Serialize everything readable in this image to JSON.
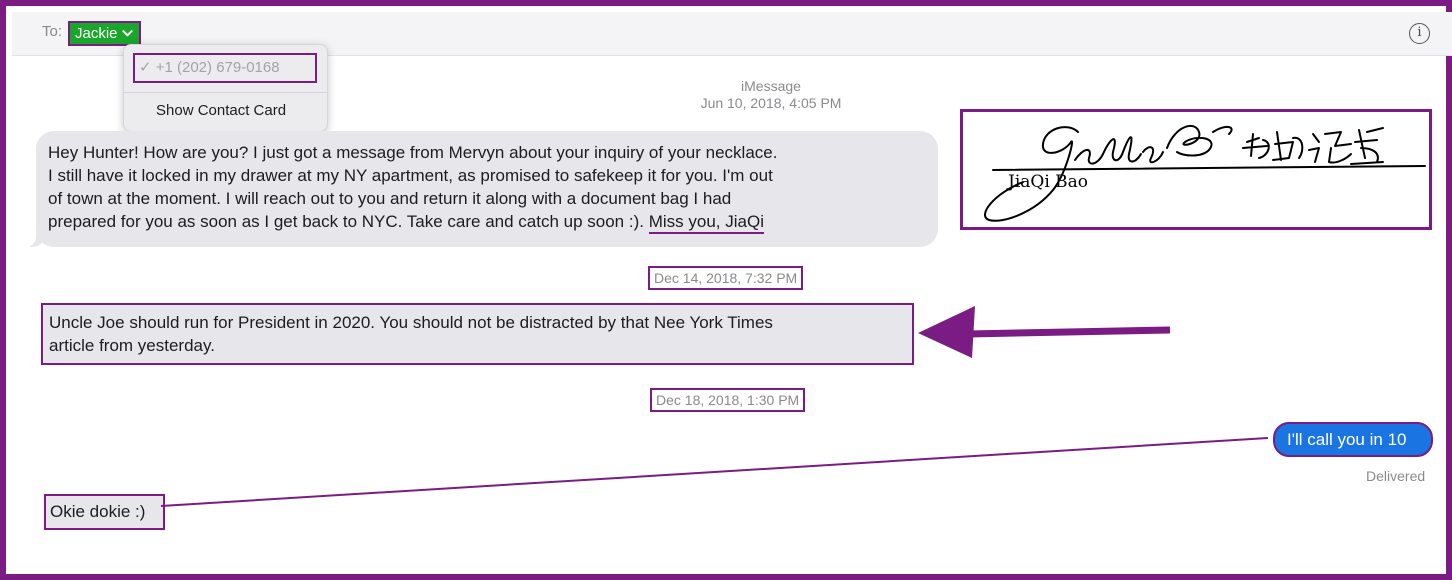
{
  "header": {
    "to_label": "To:",
    "recipient": "Jackie",
    "info_icon": "info-icon"
  },
  "dropdown": {
    "phone": "✓ +1 (202) 679-0168",
    "show_contact": "Show Contact Card"
  },
  "conversation": {
    "service": "iMessage",
    "first_timestamp": "Jun 10, 2018, 4:05 PM",
    "message_1": {
      "line_1": "Hey Hunter!  How are you?  I just got a message from Mervyn about your inquiry of your necklace.",
      "line_2": "I still have it locked in my drawer at my NY apartment, as promised to safekeep it for you.  I'm out",
      "line_3": "of town at the moment.  I will reach out to you and return it along with a document bag I had",
      "line_4_start": "prepared for you as soon as I get back to NYC.  Take care and catch up soon :).",
      "line_4_end": "Miss you, JiaQi"
    },
    "second_timestamp": "Dec 14, 2018, 7:32 PM",
    "message_2": {
      "line_1": "Uncle Joe should run for President in 2020. You should not be distracted by that Nee York Times",
      "line_2": "article from yesterday."
    },
    "third_timestamp": "Dec 18, 2018, 1:30 PM",
    "outgoing_message": "I'll call you in 10",
    "delivered": "Delivered",
    "message_3": "Okie dokie :)"
  },
  "signature": {
    "printed_name": "JiaQi Bao"
  },
  "colors": {
    "annotation": "#7a1c84",
    "recipient_bg": "#19a62a",
    "outgoing_bubble": "#1a74e2",
    "incoming_bubble": "#e6e6eb"
  }
}
